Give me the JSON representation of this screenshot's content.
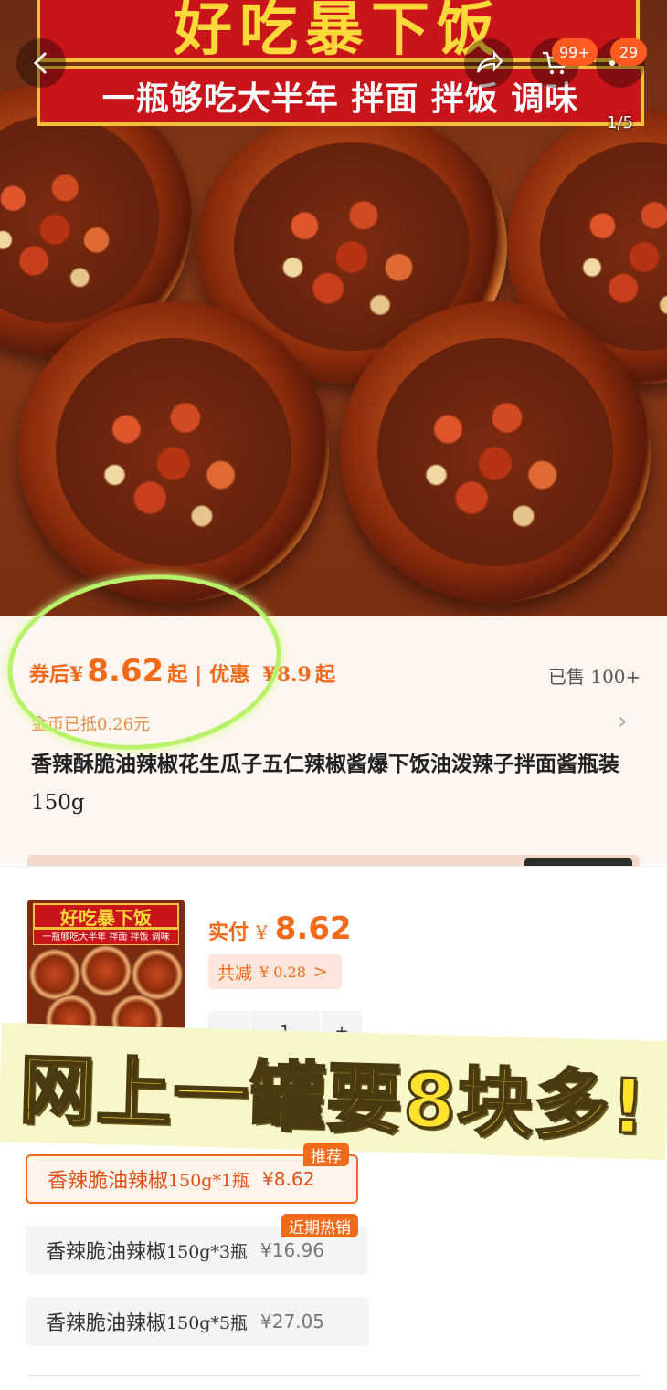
{
  "banner": {
    "title": "好吃暴下饭",
    "subtitle": "一瓶够吃大半年 拌面 拌饭 调味",
    "image_counter": "1/5"
  },
  "topbar": {
    "back_icon": "chevron-left-icon",
    "share_icon": "share-icon",
    "cart_icon": "cart-icon",
    "cart_badge": "99+",
    "more_badge": "29"
  },
  "price": {
    "coupon_label": "券后",
    "currency": "¥",
    "coupon_price": "8.62",
    "from_suffix": "起",
    "separator": "|",
    "promo_label": "优惠",
    "promo_price": "¥8.9",
    "promo_suffix": "起",
    "sold": "已售 100+",
    "coin_note": "金币已抵0.26元"
  },
  "product": {
    "title_main": "香辣酥脆油辣椒花生瓜子五仁辣椒酱爆下饭油泼辣子拌面酱瓶装",
    "title_unit": "150g"
  },
  "sku": {
    "thumb_title": "好吃暴下饭",
    "thumb_subtitle": "一瓶够吃大半年 拌面 拌饭 调味",
    "pay_label": "实付",
    "pay_currency": "¥",
    "pay_amount": "8.62",
    "discount_label": "共减",
    "discount_value": "¥ 0.28",
    "discount_arrow": ">",
    "qty_minus": "−",
    "qty_value": "1",
    "qty_plus": "+"
  },
  "overlay_caption": "网上一罐要8块多!",
  "options": [
    {
      "name": "香辣脆油辣椒",
      "spec": "150g*1瓶",
      "price": "¥8.62",
      "tag": "推荐"
    },
    {
      "name": "香辣脆油辣椒",
      "spec": "150g*3瓶",
      "price": "¥16.96",
      "tag": "近期热销"
    },
    {
      "name": "香辣脆油辣椒",
      "spec": "150g*5瓶",
      "price": "¥27.05",
      "tag": ""
    }
  ],
  "colors": {
    "accent": "#f06a1a",
    "banner_red": "#c8141a",
    "banner_yellow": "#ffd83a",
    "highlight_circle": "#b8f26a",
    "overlay_text": "#ffe22e"
  }
}
